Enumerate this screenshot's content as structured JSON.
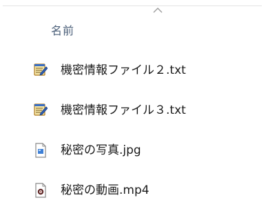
{
  "header": {
    "name_column_label": "名前",
    "sort_indicator_icon": "chevron-up-icon"
  },
  "files": [
    {
      "name": "機密情報ファイル２.txt",
      "icon": "notepad-text-file-icon"
    },
    {
      "name": "機密情報ファイル３.txt",
      "icon": "notepad-text-file-icon"
    },
    {
      "name": "秘密の写真.jpg",
      "icon": "image-file-icon"
    },
    {
      "name": "秘密の動画.mp4",
      "icon": "video-file-icon"
    }
  ],
  "colors": {
    "header_text": "#4c607a",
    "item_text": "#1a1a1a"
  }
}
